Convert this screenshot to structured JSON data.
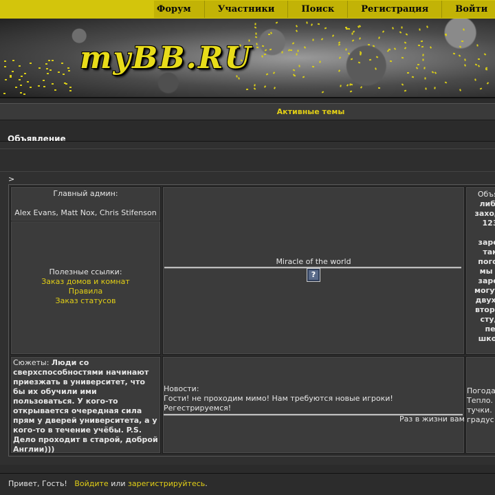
{
  "nav": {
    "items": [
      "Форум",
      "Участники",
      "Поиск",
      "Регистрация",
      "Войти"
    ]
  },
  "banner": {
    "logo_text": "myBB.RU"
  },
  "active_topics": "Активные темы",
  "announcement": {
    "title": "Объявление",
    "gt": ">"
  },
  "admin": {
    "heading": "Главный админ:",
    "names": "Alex Evans, Matt Nox, Chris Stifenson"
  },
  "links": {
    "heading": "Полезные ссылки:",
    "items": [
      "Заказ домов и комнат",
      "Правила",
      "Заказ статусов"
    ]
  },
  "middle": {
    "caption": "Miracle of the world",
    "icon": "?"
  },
  "right_column": {
    "lines": [
      "Объяв",
      "либо",
      "заходи",
      "123",
      "",
      "зарег",
      "так",
      "погов",
      "мы р",
      "зарег",
      "могут з",
      "двух м",
      "второй",
      "студ",
      "пе",
      "школ"
    ]
  },
  "plot": {
    "label": "Сюжеты:",
    "text": "Люди со сверхспособностями начинают приезжать в университет, что бы их обучили ими пользоваться. У кого-то открывается очередная сила прям у дверей университета, а у кого-то в течение учёбы. P.S. Дело проходит в старой, доброй Англии)))"
  },
  "news": {
    "label": "Новости:",
    "line1": "Гости! не проходим мимо! Нам требуются новые игроки!",
    "line2": "Регестрируемся!",
    "marquee": "Раз в жизни вам"
  },
  "weather": {
    "lines": [
      "Погода",
      "Тепло.",
      "тучки.",
      "градус"
    ]
  },
  "footer": {
    "greeting": "Привет, Гость!",
    "login": "Войдите",
    "or": "или",
    "register": "зарегистрируйтесь",
    "dot": "."
  },
  "colors": {
    "accent": "#e2cf16",
    "nav_bg": "#c2b306",
    "page_bg": "#2b2b2b"
  }
}
